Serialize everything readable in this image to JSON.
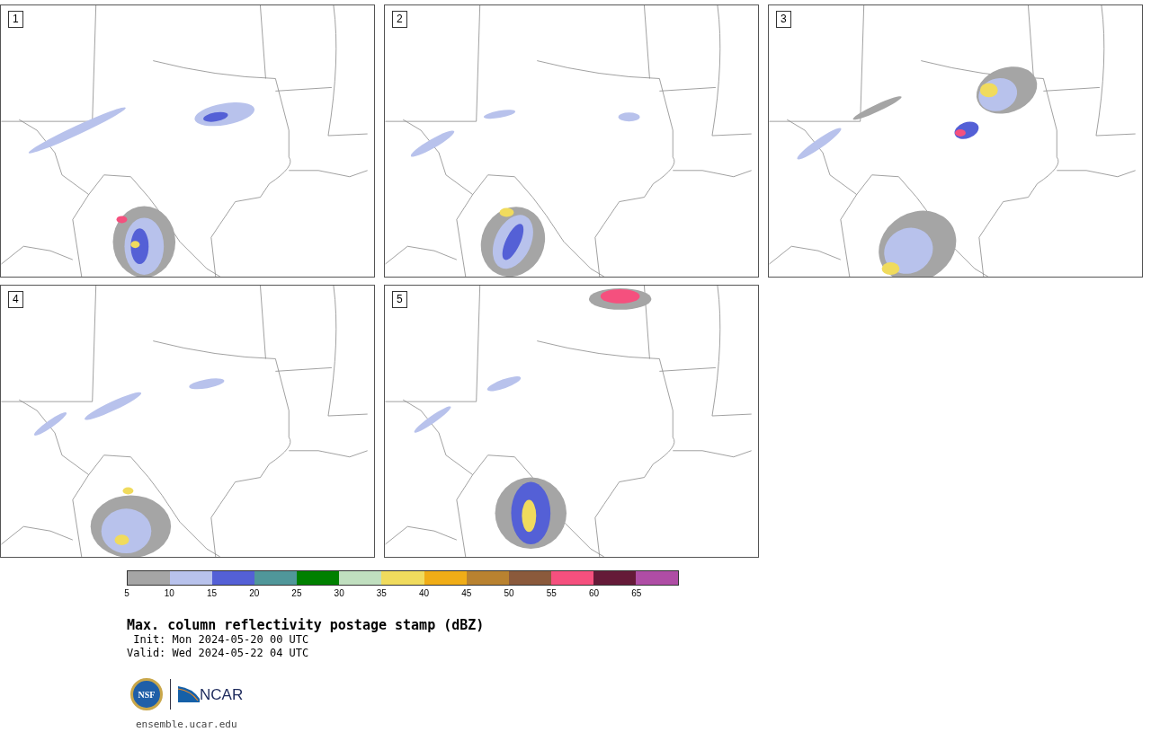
{
  "panels": [
    {
      "label": "1"
    },
    {
      "label": "2"
    },
    {
      "label": "3"
    },
    {
      "label": "4"
    },
    {
      "label": "5"
    }
  ],
  "colorbar": {
    "bins": [
      {
        "color": "#a5a5a5"
      },
      {
        "color": "#b8c2ec"
      },
      {
        "color": "#5460d6"
      },
      {
        "color": "#50979a"
      },
      {
        "color": "#008000"
      },
      {
        "color": "#c0dfbf"
      },
      {
        "color": "#f0db5d"
      },
      {
        "color": "#f0ad17"
      },
      {
        "color": "#b98230"
      },
      {
        "color": "#8b5a3c"
      },
      {
        "color": "#f5507e"
      },
      {
        "color": "#651a38"
      },
      {
        "color": "#af4da5"
      }
    ],
    "ticks": [
      "5",
      "10",
      "15",
      "20",
      "25",
      "30",
      "35",
      "40",
      "45",
      "50",
      "55",
      "60",
      "65"
    ]
  },
  "title": "Max. column reflectivity postage stamp (dBZ)",
  "init": " Init: Mon 2024-05-20 00 UTC",
  "valid": "Valid: Wed 2024-05-22 04 UTC",
  "logos": {
    "nsf": "NSF",
    "ncar": "NCAR"
  },
  "url": "ensemble.ucar.edu"
}
